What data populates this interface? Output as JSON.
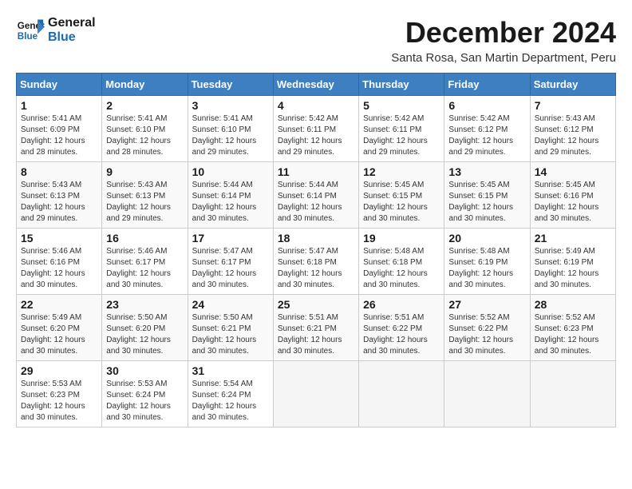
{
  "logo": {
    "line1": "General",
    "line2": "Blue"
  },
  "title": "December 2024",
  "location": "Santa Rosa, San Martin Department, Peru",
  "days_of_week": [
    "Sunday",
    "Monday",
    "Tuesday",
    "Wednesday",
    "Thursday",
    "Friday",
    "Saturday"
  ],
  "weeks": [
    [
      {
        "day": "1",
        "info": "Sunrise: 5:41 AM\nSunset: 6:09 PM\nDaylight: 12 hours\nand 28 minutes."
      },
      {
        "day": "2",
        "info": "Sunrise: 5:41 AM\nSunset: 6:10 PM\nDaylight: 12 hours\nand 28 minutes."
      },
      {
        "day": "3",
        "info": "Sunrise: 5:41 AM\nSunset: 6:10 PM\nDaylight: 12 hours\nand 29 minutes."
      },
      {
        "day": "4",
        "info": "Sunrise: 5:42 AM\nSunset: 6:11 PM\nDaylight: 12 hours\nand 29 minutes."
      },
      {
        "day": "5",
        "info": "Sunrise: 5:42 AM\nSunset: 6:11 PM\nDaylight: 12 hours\nand 29 minutes."
      },
      {
        "day": "6",
        "info": "Sunrise: 5:42 AM\nSunset: 6:12 PM\nDaylight: 12 hours\nand 29 minutes."
      },
      {
        "day": "7",
        "info": "Sunrise: 5:43 AM\nSunset: 6:12 PM\nDaylight: 12 hours\nand 29 minutes."
      }
    ],
    [
      {
        "day": "8",
        "info": "Sunrise: 5:43 AM\nSunset: 6:13 PM\nDaylight: 12 hours\nand 29 minutes."
      },
      {
        "day": "9",
        "info": "Sunrise: 5:43 AM\nSunset: 6:13 PM\nDaylight: 12 hours\nand 29 minutes."
      },
      {
        "day": "10",
        "info": "Sunrise: 5:44 AM\nSunset: 6:14 PM\nDaylight: 12 hours\nand 30 minutes."
      },
      {
        "day": "11",
        "info": "Sunrise: 5:44 AM\nSunset: 6:14 PM\nDaylight: 12 hours\nand 30 minutes."
      },
      {
        "day": "12",
        "info": "Sunrise: 5:45 AM\nSunset: 6:15 PM\nDaylight: 12 hours\nand 30 minutes."
      },
      {
        "day": "13",
        "info": "Sunrise: 5:45 AM\nSunset: 6:15 PM\nDaylight: 12 hours\nand 30 minutes."
      },
      {
        "day": "14",
        "info": "Sunrise: 5:45 AM\nSunset: 6:16 PM\nDaylight: 12 hours\nand 30 minutes."
      }
    ],
    [
      {
        "day": "15",
        "info": "Sunrise: 5:46 AM\nSunset: 6:16 PM\nDaylight: 12 hours\nand 30 minutes."
      },
      {
        "day": "16",
        "info": "Sunrise: 5:46 AM\nSunset: 6:17 PM\nDaylight: 12 hours\nand 30 minutes."
      },
      {
        "day": "17",
        "info": "Sunrise: 5:47 AM\nSunset: 6:17 PM\nDaylight: 12 hours\nand 30 minutes."
      },
      {
        "day": "18",
        "info": "Sunrise: 5:47 AM\nSunset: 6:18 PM\nDaylight: 12 hours\nand 30 minutes."
      },
      {
        "day": "19",
        "info": "Sunrise: 5:48 AM\nSunset: 6:18 PM\nDaylight: 12 hours\nand 30 minutes."
      },
      {
        "day": "20",
        "info": "Sunrise: 5:48 AM\nSunset: 6:19 PM\nDaylight: 12 hours\nand 30 minutes."
      },
      {
        "day": "21",
        "info": "Sunrise: 5:49 AM\nSunset: 6:19 PM\nDaylight: 12 hours\nand 30 minutes."
      }
    ],
    [
      {
        "day": "22",
        "info": "Sunrise: 5:49 AM\nSunset: 6:20 PM\nDaylight: 12 hours\nand 30 minutes."
      },
      {
        "day": "23",
        "info": "Sunrise: 5:50 AM\nSunset: 6:20 PM\nDaylight: 12 hours\nand 30 minutes."
      },
      {
        "day": "24",
        "info": "Sunrise: 5:50 AM\nSunset: 6:21 PM\nDaylight: 12 hours\nand 30 minutes."
      },
      {
        "day": "25",
        "info": "Sunrise: 5:51 AM\nSunset: 6:21 PM\nDaylight: 12 hours\nand 30 minutes."
      },
      {
        "day": "26",
        "info": "Sunrise: 5:51 AM\nSunset: 6:22 PM\nDaylight: 12 hours\nand 30 minutes."
      },
      {
        "day": "27",
        "info": "Sunrise: 5:52 AM\nSunset: 6:22 PM\nDaylight: 12 hours\nand 30 minutes."
      },
      {
        "day": "28",
        "info": "Sunrise: 5:52 AM\nSunset: 6:23 PM\nDaylight: 12 hours\nand 30 minutes."
      }
    ],
    [
      {
        "day": "29",
        "info": "Sunrise: 5:53 AM\nSunset: 6:23 PM\nDaylight: 12 hours\nand 30 minutes."
      },
      {
        "day": "30",
        "info": "Sunrise: 5:53 AM\nSunset: 6:24 PM\nDaylight: 12 hours\nand 30 minutes."
      },
      {
        "day": "31",
        "info": "Sunrise: 5:54 AM\nSunset: 6:24 PM\nDaylight: 12 hours\nand 30 minutes."
      },
      {
        "day": "",
        "info": ""
      },
      {
        "day": "",
        "info": ""
      },
      {
        "day": "",
        "info": ""
      },
      {
        "day": "",
        "info": ""
      }
    ]
  ]
}
